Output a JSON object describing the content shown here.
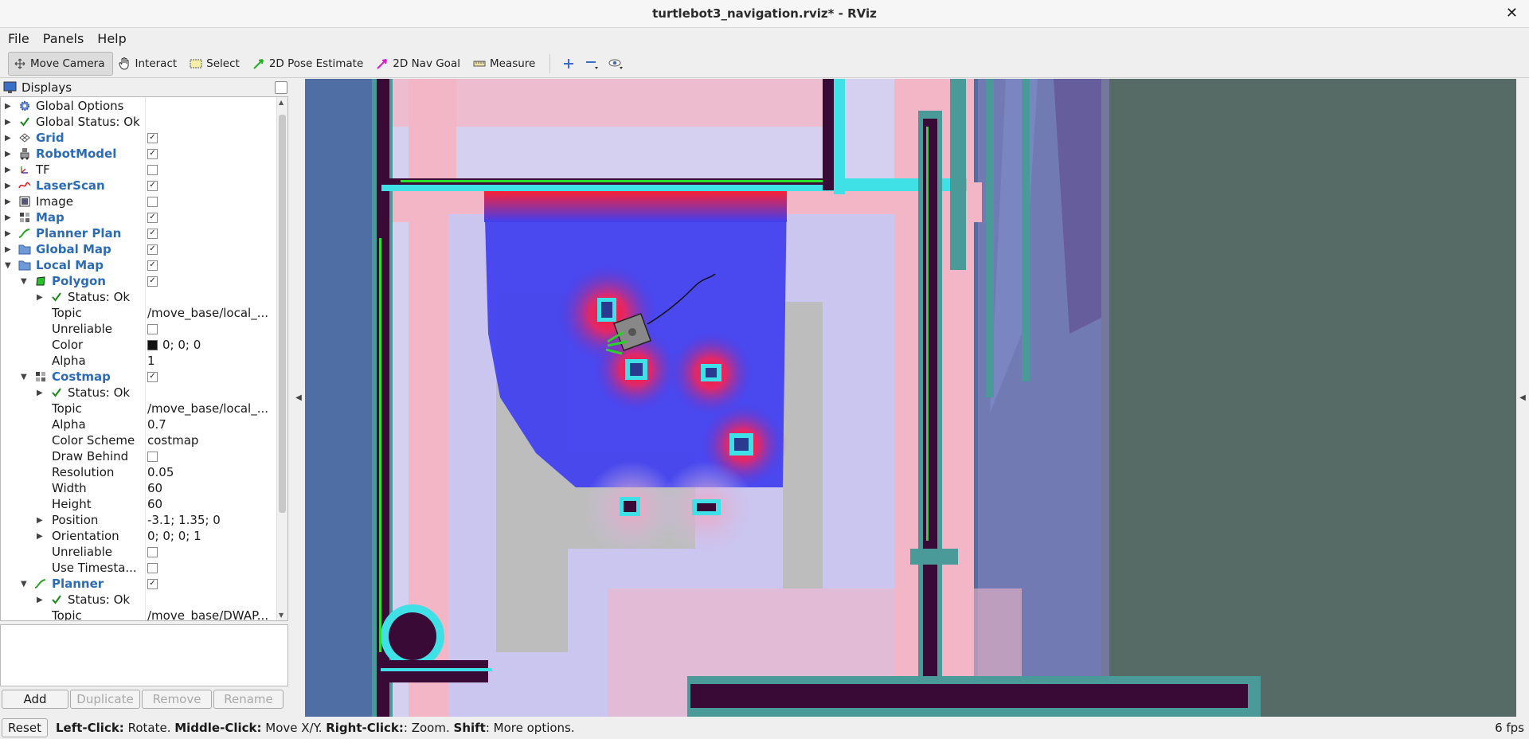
{
  "window": {
    "title": "turtlebot3_navigation.rviz* - RViz",
    "close_glyph": "✕"
  },
  "menubar": {
    "items": [
      "File",
      "Panels",
      "Help"
    ]
  },
  "toolbar": {
    "tools": [
      {
        "label": "Move Camera",
        "icon": "move-camera-icon",
        "active": true
      },
      {
        "label": "Interact",
        "icon": "hand-icon",
        "active": false
      },
      {
        "label": "Select",
        "icon": "select-box-icon",
        "active": false
      },
      {
        "label": "2D Pose Estimate",
        "icon": "green-arrow-icon",
        "active": false
      },
      {
        "label": "2D Nav Goal",
        "icon": "magenta-arrow-icon",
        "active": false
      },
      {
        "label": "Measure",
        "icon": "ruler-icon",
        "active": false
      }
    ],
    "extra_icons": [
      "plus-icon",
      "minus-icon",
      "eye-icon"
    ]
  },
  "displays_panel": {
    "title": "Displays",
    "rows": [
      {
        "depth": 0,
        "expanded": false,
        "icon": "gear-blue-icon",
        "name": "Global Options",
        "bold": false,
        "value": "",
        "checkbox": null
      },
      {
        "depth": 0,
        "expanded": false,
        "icon": "check-icon",
        "name": "Global Status: Ok",
        "bold": false,
        "value": "",
        "checkbox": null
      },
      {
        "depth": 0,
        "expanded": false,
        "icon": "grid-icon",
        "name": "Grid",
        "bold": true,
        "value": "",
        "checkbox": true
      },
      {
        "depth": 0,
        "expanded": false,
        "icon": "robot-icon",
        "name": "RobotModel",
        "bold": true,
        "value": "",
        "checkbox": true
      },
      {
        "depth": 0,
        "expanded": false,
        "icon": "tf-icon",
        "name": "TF",
        "bold": false,
        "value": "",
        "checkbox": false
      },
      {
        "depth": 0,
        "expanded": false,
        "icon": "laser-icon",
        "name": "LaserScan",
        "bold": true,
        "value": "",
        "checkbox": true
      },
      {
        "depth": 0,
        "expanded": false,
        "icon": "image-icon",
        "name": "Image",
        "bold": false,
        "value": "",
        "checkbox": false
      },
      {
        "depth": 0,
        "expanded": false,
        "icon": "map-icon",
        "name": "Map",
        "bold": true,
        "value": "",
        "checkbox": true
      },
      {
        "depth": 0,
        "expanded": false,
        "icon": "path-icon",
        "name": "Planner Plan",
        "bold": true,
        "value": "",
        "checkbox": true
      },
      {
        "depth": 0,
        "expanded": false,
        "icon": "folder-icon",
        "name": "Global Map",
        "bold": true,
        "value": "",
        "checkbox": true
      },
      {
        "depth": 0,
        "expanded": true,
        "icon": "folder-icon",
        "name": "Local Map",
        "bold": true,
        "value": "",
        "checkbox": true
      },
      {
        "depth": 1,
        "expanded": true,
        "icon": "polygon-icon",
        "name": "Polygon",
        "bold": true,
        "value": "",
        "checkbox": true
      },
      {
        "depth": 2,
        "expanded": false,
        "icon": "check-icon",
        "name": "Status: Ok",
        "bold": false,
        "value": "",
        "checkbox": null
      },
      {
        "depth": 2,
        "expanded": null,
        "icon": "",
        "name": "Topic",
        "bold": false,
        "value": "/move_base/local_...",
        "checkbox": null
      },
      {
        "depth": 2,
        "expanded": null,
        "icon": "",
        "name": "Unreliable",
        "bold": false,
        "value": "",
        "checkbox": false
      },
      {
        "depth": 2,
        "expanded": null,
        "icon": "",
        "name": "Color",
        "bold": false,
        "value": "0; 0; 0",
        "checkbox": null,
        "swatch": "#111111"
      },
      {
        "depth": 2,
        "expanded": null,
        "icon": "",
        "name": "Alpha",
        "bold": false,
        "value": "1",
        "checkbox": null
      },
      {
        "depth": 1,
        "expanded": true,
        "icon": "map-icon",
        "name": "Costmap",
        "bold": true,
        "value": "",
        "checkbox": true
      },
      {
        "depth": 2,
        "expanded": false,
        "icon": "check-icon",
        "name": "Status: Ok",
        "bold": false,
        "value": "",
        "checkbox": null
      },
      {
        "depth": 2,
        "expanded": null,
        "icon": "",
        "name": "Topic",
        "bold": false,
        "value": "/move_base/local_...",
        "checkbox": null
      },
      {
        "depth": 2,
        "expanded": null,
        "icon": "",
        "name": "Alpha",
        "bold": false,
        "value": "0.7",
        "checkbox": null
      },
      {
        "depth": 2,
        "expanded": null,
        "icon": "",
        "name": "Color Scheme",
        "bold": false,
        "value": "costmap",
        "checkbox": null
      },
      {
        "depth": 2,
        "expanded": null,
        "icon": "",
        "name": "Draw Behind",
        "bold": false,
        "value": "",
        "checkbox": false
      },
      {
        "depth": 2,
        "expanded": null,
        "icon": "",
        "name": "Resolution",
        "bold": false,
        "value": "0.05",
        "checkbox": null
      },
      {
        "depth": 2,
        "expanded": null,
        "icon": "",
        "name": "Width",
        "bold": false,
        "value": "60",
        "checkbox": null
      },
      {
        "depth": 2,
        "expanded": null,
        "icon": "",
        "name": "Height",
        "bold": false,
        "value": "60",
        "checkbox": null
      },
      {
        "depth": 2,
        "expanded": false,
        "icon": "",
        "name": "Position",
        "bold": false,
        "value": "-3.1; 1.35; 0",
        "checkbox": null
      },
      {
        "depth": 2,
        "expanded": false,
        "icon": "",
        "name": "Orientation",
        "bold": false,
        "value": "0; 0; 0; 1",
        "checkbox": null
      },
      {
        "depth": 2,
        "expanded": null,
        "icon": "",
        "name": "Unreliable",
        "bold": false,
        "value": "",
        "checkbox": false
      },
      {
        "depth": 2,
        "expanded": null,
        "icon": "",
        "name": "Use Timesta...",
        "bold": false,
        "value": "",
        "checkbox": false
      },
      {
        "depth": 1,
        "expanded": true,
        "icon": "path-icon",
        "name": "Planner",
        "bold": true,
        "value": "",
        "checkbox": true
      },
      {
        "depth": 2,
        "expanded": false,
        "icon": "check-icon",
        "name": "Status: Ok",
        "bold": false,
        "value": "",
        "checkbox": null
      },
      {
        "depth": 2,
        "expanded": null,
        "icon": "",
        "name": "Topic",
        "bold": false,
        "value": "/move_base/DWAP...",
        "checkbox": null
      }
    ],
    "buttons": [
      {
        "label": "Add",
        "enabled": true
      },
      {
        "label": "Duplicate",
        "enabled": false
      },
      {
        "label": "Remove",
        "enabled": false
      },
      {
        "label": "Rename",
        "enabled": false
      }
    ]
  },
  "statusbar": {
    "reset_label": "Reset",
    "hint": [
      {
        "key": "Left-Click:",
        "text": " Rotate. "
      },
      {
        "key": "Middle-Click:",
        "text": " Move X/Y. "
      },
      {
        "key": "Right-Click:",
        "text": ": Zoom. "
      },
      {
        "key": "Shift",
        "text": ": More options."
      }
    ],
    "fps": "6 fps"
  },
  "colors": {
    "viewport_background": "#4f6ea4",
    "wall": "#3a0a36",
    "inflation_cyan": "#3fe0e6",
    "costmap_blue": "#3f3ef0",
    "costmap_red": "#ff1a2a",
    "laser_green": "#2adf2a",
    "unknown_gray": "#566a66"
  }
}
